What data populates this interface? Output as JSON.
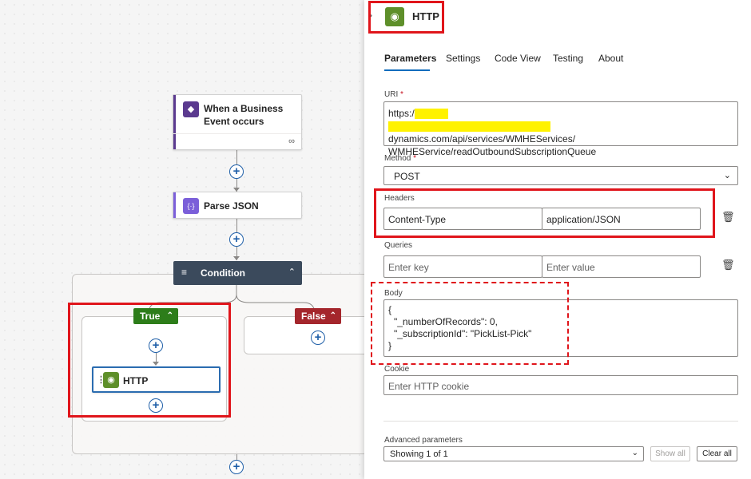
{
  "canvas": {
    "trigger": {
      "title": "When a Business Event occurs"
    },
    "parse_json": {
      "title": "Parse JSON"
    },
    "condition": {
      "title": "Condition"
    },
    "true_branch": {
      "label": "True"
    },
    "false_branch": {
      "label": "False"
    },
    "http_action": {
      "title": "HTTP"
    }
  },
  "panel": {
    "title": "HTTP",
    "tabs": [
      "Parameters",
      "Settings",
      "Code View",
      "Testing",
      "About"
    ],
    "uri": {
      "label": "URI",
      "required_mark": "*",
      "line1_prefix": "https:/",
      "line2_suffix": "dynamics.com/api/services/WMHEServices/",
      "line3": "WMHEService/readOutboundSubscriptionQueue"
    },
    "method": {
      "label": "Method",
      "required_mark": "*",
      "value": "POST"
    },
    "headers": {
      "label": "Headers",
      "key": "Content-Type",
      "value": "application/JSON"
    },
    "queries": {
      "label": "Queries",
      "key_placeholder": "Enter key",
      "value_placeholder": "Enter value"
    },
    "body": {
      "label": "Body",
      "lines": [
        "{",
        "\"_numberOfRecords\": 0,",
        "\"_subscriptionId\": \"PickList-Pick\"",
        "}"
      ]
    },
    "cookie": {
      "label": "Cookie",
      "placeholder": "Enter HTTP cookie"
    },
    "advanced": {
      "label": "Advanced parameters",
      "value": "Showing 1 of 1",
      "show_all": "Show all",
      "clear_all": "Clear all"
    }
  },
  "colors": {
    "http_icon": "#5e8f2a",
    "parse_icon": "#7b5fd9",
    "trigger_icon": "#5b3a8f",
    "true_branch": "#2d7d1a",
    "false_branch": "#a4262c",
    "highlight": "#e0151b",
    "tab_underline": "#0f6cbd"
  }
}
